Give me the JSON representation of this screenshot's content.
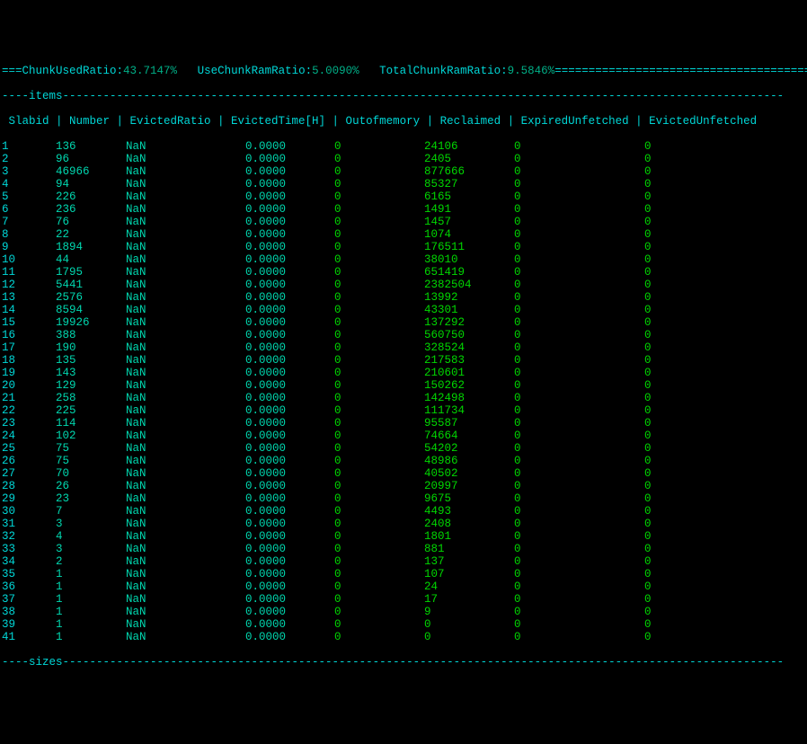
{
  "topbar_prefix": "===",
  "stats": [
    {
      "label": "ChunkUsedRatio:",
      "value": "43.7147%"
    },
    {
      "label": "UseChunkRamRatio:",
      "value": "5.0090%"
    },
    {
      "label": "TotalChunkRamRatio:",
      "value": "9.5846%"
    }
  ],
  "topbar_suffix": "=========================================",
  "frame_items_line": "----items-----------------------------------------------------------------------------------------------------------",
  "columns": [
    "Slabid",
    "Number",
    "EvictedRatio",
    "EvictedTime[H]",
    "Outofmemory",
    "Reclaimed",
    "ExpiredUnfetched",
    "EvictedUnfetched"
  ],
  "header_line": " Slabid | Number | EvictedRatio | EvictedTime[H] | Outofmemory | Reclaimed | ExpiredUnfetched | EvictedUnfetched",
  "rows": [
    {
      "slabid": "1",
      "number": "136",
      "evratio": "NaN",
      "evtime": "0.0000",
      "oom": "0",
      "reclaimed": "24106",
      "expunf": "0",
      "evunf": "0"
    },
    {
      "slabid": "2",
      "number": "96",
      "evratio": "NaN",
      "evtime": "0.0000",
      "oom": "0",
      "reclaimed": "2405",
      "expunf": "0",
      "evunf": "0"
    },
    {
      "slabid": "3",
      "number": "46966",
      "evratio": "NaN",
      "evtime": "0.0000",
      "oom": "0",
      "reclaimed": "877666",
      "expunf": "0",
      "evunf": "0"
    },
    {
      "slabid": "4",
      "number": "94",
      "evratio": "NaN",
      "evtime": "0.0000",
      "oom": "0",
      "reclaimed": "85327",
      "expunf": "0",
      "evunf": "0"
    },
    {
      "slabid": "5",
      "number": "226",
      "evratio": "NaN",
      "evtime": "0.0000",
      "oom": "0",
      "reclaimed": "6165",
      "expunf": "0",
      "evunf": "0"
    },
    {
      "slabid": "6",
      "number": "236",
      "evratio": "NaN",
      "evtime": "0.0000",
      "oom": "0",
      "reclaimed": "1491",
      "expunf": "0",
      "evunf": "0"
    },
    {
      "slabid": "7",
      "number": "76",
      "evratio": "NaN",
      "evtime": "0.0000",
      "oom": "0",
      "reclaimed": "1457",
      "expunf": "0",
      "evunf": "0"
    },
    {
      "slabid": "8",
      "number": "22",
      "evratio": "NaN",
      "evtime": "0.0000",
      "oom": "0",
      "reclaimed": "1074",
      "expunf": "0",
      "evunf": "0"
    },
    {
      "slabid": "9",
      "number": "1894",
      "evratio": "NaN",
      "evtime": "0.0000",
      "oom": "0",
      "reclaimed": "176511",
      "expunf": "0",
      "evunf": "0"
    },
    {
      "slabid": "10",
      "number": "44",
      "evratio": "NaN",
      "evtime": "0.0000",
      "oom": "0",
      "reclaimed": "38010",
      "expunf": "0",
      "evunf": "0"
    },
    {
      "slabid": "11",
      "number": "1795",
      "evratio": "NaN",
      "evtime": "0.0000",
      "oom": "0",
      "reclaimed": "651419",
      "expunf": "0",
      "evunf": "0"
    },
    {
      "slabid": "12",
      "number": "5441",
      "evratio": "NaN",
      "evtime": "0.0000",
      "oom": "0",
      "reclaimed": "2382504",
      "expunf": "0",
      "evunf": "0"
    },
    {
      "slabid": "13",
      "number": "2576",
      "evratio": "NaN",
      "evtime": "0.0000",
      "oom": "0",
      "reclaimed": "13992",
      "expunf": "0",
      "evunf": "0"
    },
    {
      "slabid": "14",
      "number": "8594",
      "evratio": "NaN",
      "evtime": "0.0000",
      "oom": "0",
      "reclaimed": "43301",
      "expunf": "0",
      "evunf": "0"
    },
    {
      "slabid": "15",
      "number": "19926",
      "evratio": "NaN",
      "evtime": "0.0000",
      "oom": "0",
      "reclaimed": "137292",
      "expunf": "0",
      "evunf": "0"
    },
    {
      "slabid": "16",
      "number": "388",
      "evratio": "NaN",
      "evtime": "0.0000",
      "oom": "0",
      "reclaimed": "560750",
      "expunf": "0",
      "evunf": "0"
    },
    {
      "slabid": "17",
      "number": "190",
      "evratio": "NaN",
      "evtime": "0.0000",
      "oom": "0",
      "reclaimed": "328524",
      "expunf": "0",
      "evunf": "0"
    },
    {
      "slabid": "18",
      "number": "135",
      "evratio": "NaN",
      "evtime": "0.0000",
      "oom": "0",
      "reclaimed": "217583",
      "expunf": "0",
      "evunf": "0"
    },
    {
      "slabid": "19",
      "number": "143",
      "evratio": "NaN",
      "evtime": "0.0000",
      "oom": "0",
      "reclaimed": "210601",
      "expunf": "0",
      "evunf": "0"
    },
    {
      "slabid": "20",
      "number": "129",
      "evratio": "NaN",
      "evtime": "0.0000",
      "oom": "0",
      "reclaimed": "150262",
      "expunf": "0",
      "evunf": "0"
    },
    {
      "slabid": "21",
      "number": "258",
      "evratio": "NaN",
      "evtime": "0.0000",
      "oom": "0",
      "reclaimed": "142498",
      "expunf": "0",
      "evunf": "0"
    },
    {
      "slabid": "22",
      "number": "225",
      "evratio": "NaN",
      "evtime": "0.0000",
      "oom": "0",
      "reclaimed": "111734",
      "expunf": "0",
      "evunf": "0"
    },
    {
      "slabid": "23",
      "number": "114",
      "evratio": "NaN",
      "evtime": "0.0000",
      "oom": "0",
      "reclaimed": "95587",
      "expunf": "0",
      "evunf": "0"
    },
    {
      "slabid": "24",
      "number": "102",
      "evratio": "NaN",
      "evtime": "0.0000",
      "oom": "0",
      "reclaimed": "74664",
      "expunf": "0",
      "evunf": "0"
    },
    {
      "slabid": "25",
      "number": "75",
      "evratio": "NaN",
      "evtime": "0.0000",
      "oom": "0",
      "reclaimed": "54202",
      "expunf": "0",
      "evunf": "0"
    },
    {
      "slabid": "26",
      "number": "75",
      "evratio": "NaN",
      "evtime": "0.0000",
      "oom": "0",
      "reclaimed": "48986",
      "expunf": "0",
      "evunf": "0"
    },
    {
      "slabid": "27",
      "number": "70",
      "evratio": "NaN",
      "evtime": "0.0000",
      "oom": "0",
      "reclaimed": "40502",
      "expunf": "0",
      "evunf": "0"
    },
    {
      "slabid": "28",
      "number": "26",
      "evratio": "NaN",
      "evtime": "0.0000",
      "oom": "0",
      "reclaimed": "20997",
      "expunf": "0",
      "evunf": "0"
    },
    {
      "slabid": "29",
      "number": "23",
      "evratio": "NaN",
      "evtime": "0.0000",
      "oom": "0",
      "reclaimed": "9675",
      "expunf": "0",
      "evunf": "0"
    },
    {
      "slabid": "30",
      "number": "7",
      "evratio": "NaN",
      "evtime": "0.0000",
      "oom": "0",
      "reclaimed": "4493",
      "expunf": "0",
      "evunf": "0"
    },
    {
      "slabid": "31",
      "number": "3",
      "evratio": "NaN",
      "evtime": "0.0000",
      "oom": "0",
      "reclaimed": "2408",
      "expunf": "0",
      "evunf": "0"
    },
    {
      "slabid": "32",
      "number": "4",
      "evratio": "NaN",
      "evtime": "0.0000",
      "oom": "0",
      "reclaimed": "1801",
      "expunf": "0",
      "evunf": "0"
    },
    {
      "slabid": "33",
      "number": "3",
      "evratio": "NaN",
      "evtime": "0.0000",
      "oom": "0",
      "reclaimed": "881",
      "expunf": "0",
      "evunf": "0"
    },
    {
      "slabid": "34",
      "number": "2",
      "evratio": "NaN",
      "evtime": "0.0000",
      "oom": "0",
      "reclaimed": "137",
      "expunf": "0",
      "evunf": "0"
    },
    {
      "slabid": "35",
      "number": "1",
      "evratio": "NaN",
      "evtime": "0.0000",
      "oom": "0",
      "reclaimed": "107",
      "expunf": "0",
      "evunf": "0"
    },
    {
      "slabid": "36",
      "number": "1",
      "evratio": "NaN",
      "evtime": "0.0000",
      "oom": "0",
      "reclaimed": "24",
      "expunf": "0",
      "evunf": "0"
    },
    {
      "slabid": "37",
      "number": "1",
      "evratio": "NaN",
      "evtime": "0.0000",
      "oom": "0",
      "reclaimed": "17",
      "expunf": "0",
      "evunf": "0"
    },
    {
      "slabid": "38",
      "number": "1",
      "evratio": "NaN",
      "evtime": "0.0000",
      "oom": "0",
      "reclaimed": "9",
      "expunf": "0",
      "evunf": "0"
    },
    {
      "slabid": "39",
      "number": "1",
      "evratio": "NaN",
      "evtime": "0.0000",
      "oom": "0",
      "reclaimed": "0",
      "expunf": "0",
      "evunf": "0"
    },
    {
      "slabid": "41",
      "number": "1",
      "evratio": "NaN",
      "evtime": "0.0000",
      "oom": "0",
      "reclaimed": "0",
      "expunf": "0",
      "evunf": "0"
    }
  ],
  "frame_sizes_line": "----sizes-----------------------------------------------------------------------------------------------------------"
}
